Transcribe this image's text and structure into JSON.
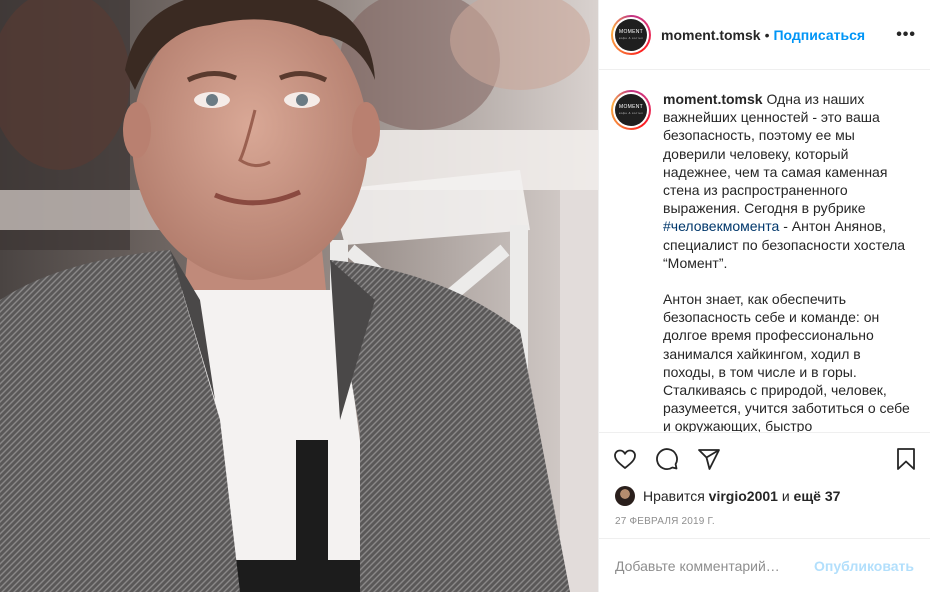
{
  "post": {
    "username": "moment.tomsk",
    "separator": "•",
    "follow_label": "Подписаться",
    "more_label": "•••",
    "avatar_text": "MOMENT",
    "avatar_subtext": "кофе & хостел",
    "caption": {
      "author": "moment.tomsk",
      "text_part1": "Одна из наших важнейших ценностей - это ваша безопасность, поэтому ее мы доверили человеку, который надежнее, чем та самая каменная стена из распространенного выражения. Сегодня в рубрике ",
      "hashtag": "#человекмомента",
      "text_part2": " - Антон Анянов, специалист по безопасности хостела “Момент”.",
      "paragraph2": "Антон знает, как обеспечить безопасность себе и команде: он долгое время профессионально занимался хайкингом, ходил в походы, в том числе и в горы. Сталкиваясь с природой, человек, разумеется, учится заботиться о себе и окружающих, быстро"
    },
    "likes": {
      "prefix": "Нравится",
      "user": "virgio2001",
      "middle": "и",
      "count_label": "ещё 37"
    },
    "date": "27 ФЕВРАЛЯ 2019 Г.",
    "comment": {
      "placeholder": "Добавьте комментарий…",
      "publish_label": "Опубликовать"
    }
  },
  "icons": {
    "like": "heart-icon",
    "comment": "comment-icon",
    "share": "share-icon",
    "save": "bookmark-icon",
    "more": "more-icon"
  },
  "colors": {
    "link_blue": "#0095f6",
    "hashtag": "#00376b",
    "muted": "#8e8e8e",
    "publish_disabled": "#b2dffc",
    "border": "#efefef"
  }
}
